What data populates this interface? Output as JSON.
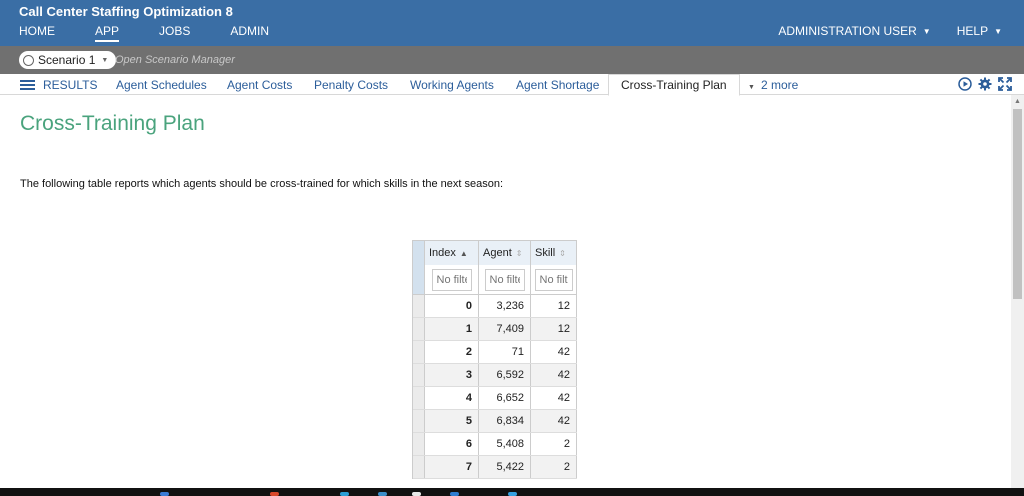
{
  "header": {
    "app_title": "Call Center Staffing Optimization 8",
    "nav": [
      "HOME",
      "APP",
      "JOBS",
      "ADMIN"
    ],
    "active_nav": "APP",
    "user_menu": "ADMINISTRATION USER",
    "help_menu": "HELP"
  },
  "scenario": {
    "name": "Scenario 1",
    "open_manager": "Open Scenario Manager"
  },
  "tabs": {
    "results_label": "RESULTS",
    "items": [
      "Agent Schedules",
      "Agent Costs",
      "Penalty Costs",
      "Working Agents",
      "Agent Shortage",
      "Cross-Training Plan"
    ],
    "active": "Cross-Training Plan",
    "more_label": "2 more"
  },
  "toolbar_icons": [
    "play-icon",
    "gear-icon",
    "fullscreen-icon"
  ],
  "page": {
    "title": "Cross-Training Plan",
    "description": "The following table reports which agents should be cross-trained for which skills in the next season:"
  },
  "table": {
    "columns": [
      "Index",
      "Agent",
      "Skill"
    ],
    "filter_placeholder": "No filter",
    "rows": [
      [
        "0",
        "3,236",
        "12"
      ],
      [
        "1",
        "7,409",
        "12"
      ],
      [
        "2",
        "71",
        "42"
      ],
      [
        "3",
        "6,592",
        "42"
      ],
      [
        "4",
        "6,652",
        "42"
      ],
      [
        "5",
        "6,834",
        "42"
      ],
      [
        "6",
        "5,408",
        "2"
      ],
      [
        "7",
        "5,422",
        "2"
      ]
    ]
  },
  "colors": {
    "header_bg": "#3a6ea5",
    "scenario_bar_bg": "#707070",
    "link": "#2b5d9a",
    "title_green": "#4aa37d"
  }
}
